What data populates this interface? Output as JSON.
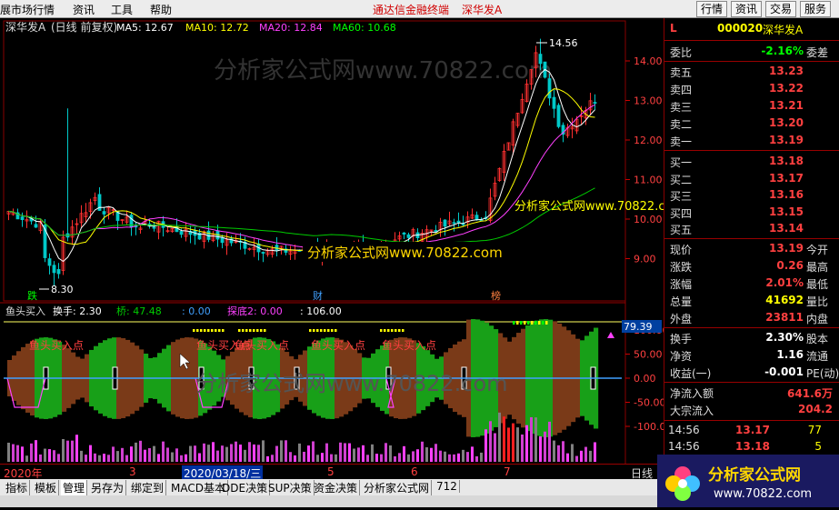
{
  "menubar": {
    "items": [
      "展市场行情",
      "资讯",
      "工具",
      "帮助"
    ],
    "promo": [
      "通达信金融终端",
      "深华发A"
    ],
    "right_buttons": [
      "行情",
      "资讯",
      "交易",
      "服务"
    ]
  },
  "main_chart": {
    "stock_title": "深华发A",
    "mode": "(日线 前复权)",
    "ma": [
      {
        "label": "MA5: 12.67",
        "color": "#ffffff"
      },
      {
        "label": "MA10: 12.72",
        "color": "#ffff00"
      },
      {
        "label": "MA20: 12.84",
        "color": "#ff40ff"
      },
      {
        "label": "MA60: 10.68",
        "color": "#00ff00"
      }
    ],
    "watermark": "分析家公式网www.70822.com",
    "overlay_text_1": "分析家公式网www.70822.com",
    "overlay_text_2": "分析家公式网www.70822.com",
    "high_label": "14.56",
    "low_label": "8.30",
    "y_ticks": [
      "14.00",
      "13.00",
      "12.00",
      "11.00",
      "10.00",
      "9.00"
    ],
    "markers": [
      "跌",
      "财",
      "榜"
    ]
  },
  "indicator": {
    "title": "鱼头买入",
    "items": [
      {
        "label": "换手: 2.30",
        "color": "#ffffff"
      },
      {
        "label": "桥: 47.48",
        "color": "#00cc00"
      },
      {
        "label": ": 0.00",
        "color": "#40a0ff"
      },
      {
        "label": "探底2: 0.00",
        "color": "#ff40ff"
      },
      {
        "label": ": 106.00",
        "color": "#ffffff"
      }
    ],
    "buy_label": "鱼头买入点",
    "y_ticks": [
      "100.00",
      "50.00",
      "0.00",
      "-50.00",
      "-100.00"
    ],
    "current": "79.39",
    "watermark": "分析家公式网www.70822.com"
  },
  "datebar": {
    "labels": [
      "2020年",
      "3",
      "2020/03/18/三",
      "5",
      "6",
      "7"
    ],
    "right": "日线"
  },
  "tabs": [
    "指标",
    "模板",
    "管理",
    "另存为",
    "绑定到",
    "MACD基本",
    "DDE决策",
    "SUP决策",
    "资金决策",
    "分析家公式网",
    "712"
  ],
  "quote": {
    "code": "000020",
    "name": "深华发A",
    "l": "L",
    "weibi": {
      "label": "委比",
      "value": "-2.16%",
      "right": "委差"
    },
    "asks": [
      {
        "label": "卖五",
        "price": "13.23"
      },
      {
        "label": "卖四",
        "price": "13.22"
      },
      {
        "label": "卖三",
        "price": "13.21"
      },
      {
        "label": "卖二",
        "price": "13.20"
      },
      {
        "label": "卖一",
        "price": "13.19"
      }
    ],
    "bids": [
      {
        "label": "买一",
        "price": "13.18"
      },
      {
        "label": "买二",
        "price": "13.17"
      },
      {
        "label": "买三",
        "price": "13.16"
      },
      {
        "label": "买四",
        "price": "13.15"
      },
      {
        "label": "买五",
        "price": "13.14"
      }
    ],
    "stats": [
      {
        "label": "现价",
        "value": "13.19",
        "right": "今开",
        "color": "#ff4040"
      },
      {
        "label": "涨跌",
        "value": "0.26",
        "right": "最高",
        "color": "#ff4040"
      },
      {
        "label": "涨幅",
        "value": "2.01%",
        "right": "最低",
        "color": "#ff4040"
      },
      {
        "label": "总量",
        "value": "41692",
        "right": "量比",
        "color": "#ffff00"
      },
      {
        "label": "外盘",
        "value": "23811",
        "right": "内盘",
        "color": "#ff4040"
      }
    ],
    "stats2": [
      {
        "label": "换手",
        "value": "2.30%",
        "right": "股本",
        "color": "#ffffff"
      },
      {
        "label": "净资",
        "value": "1.16",
        "right": "流通",
        "color": "#ffffff"
      },
      {
        "label": "收益(一)",
        "value": "-0.001",
        "right": "PE(动)",
        "color": "#ffffff"
      }
    ],
    "flow": [
      {
        "label": "净流入额",
        "value": "641.6万",
        "color": "#ff4040"
      },
      {
        "label": "大宗流入",
        "value": "204.2",
        "color": "#ff4040"
      }
    ],
    "ticks": [
      {
        "time": "14:56",
        "price": "13.17",
        "vol": "77"
      },
      {
        "time": "14:56",
        "price": "13.18",
        "vol": "5"
      }
    ]
  },
  "logo": {
    "name": "分析家公式网",
    "url": "www.70822.com"
  }
}
